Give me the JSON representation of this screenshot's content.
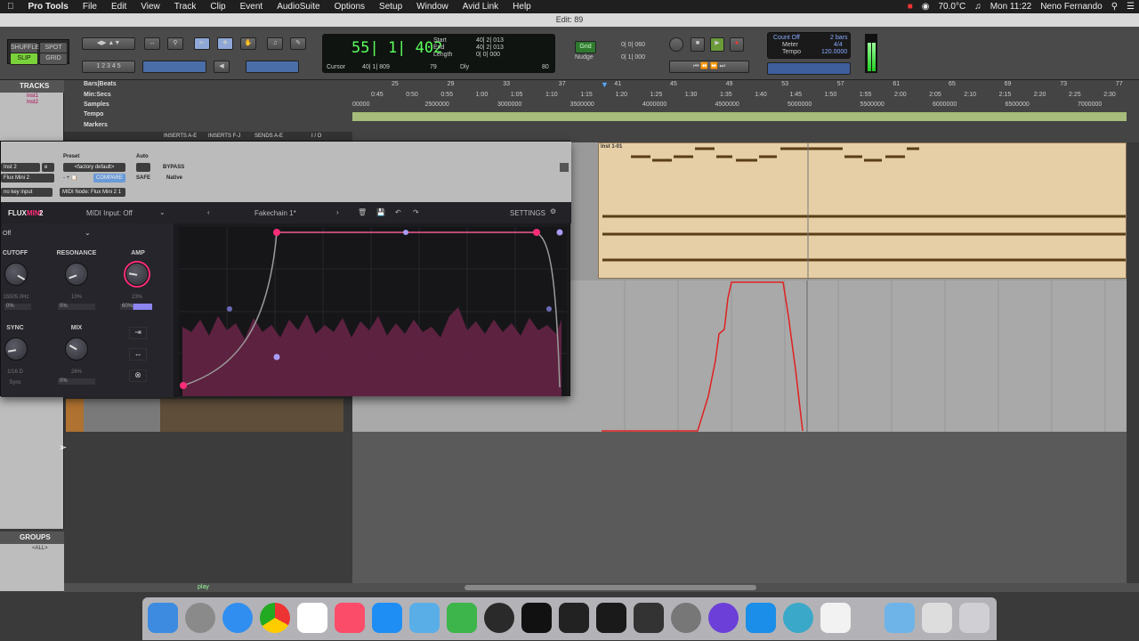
{
  "menubar": {
    "app": "Pro Tools",
    "items": [
      "File",
      "Edit",
      "View",
      "Track",
      "Clip",
      "Event",
      "AudioSuite",
      "Options",
      "Setup",
      "Window",
      "Avid Link",
      "Help"
    ],
    "temp": "70.0°C",
    "clock": "Mon 11:22",
    "user": "Neno Fernando"
  },
  "window_title": "Edit: 89",
  "toolbar": {
    "modes": [
      "SHUFFLE",
      "SPOT",
      "SLIP",
      "GRID"
    ],
    "main_counter": "55| 1| 402",
    "start_lbl": "Start",
    "end_lbl": "End",
    "length_lbl": "Length",
    "start": "40| 2| 013",
    "end": "40| 2| 013",
    "length": "0| 0| 000",
    "cursor_lbl": "Cursor",
    "cursor": "40| 1| 809",
    "cursor_num": "79",
    "dly": "Dly",
    "grid_lbl": "Grid",
    "grid_val": "0| 0| 060",
    "nudge_lbl": "Nudge",
    "nudge_val": "0| 1| 000",
    "count_off": "Count Off",
    "meter": "Meter",
    "tempo": "Tempo",
    "bars": "2 bars",
    "meter_val": "4/4",
    "tempo_val": "120.0000",
    "cursor_badge": "80"
  },
  "rulers": {
    "labels": [
      "Bars|Beats",
      "Min:Secs",
      "Samples",
      "Tempo",
      "Markers"
    ],
    "bars": [
      {
        "t": "25"
      },
      {
        "t": "29"
      },
      {
        "t": "33"
      },
      {
        "t": "37"
      },
      {
        "t": "41"
      },
      {
        "t": "45"
      },
      {
        "t": "49"
      },
      {
        "t": "53"
      },
      {
        "t": "57"
      },
      {
        "t": "61"
      },
      {
        "t": "65"
      },
      {
        "t": "69"
      },
      {
        "t": "73"
      },
      {
        "t": "77"
      }
    ],
    "mins": [
      "0:45",
      "0:50",
      "0:55",
      "1:00",
      "1:05",
      "1:10",
      "1:15",
      "1:20",
      "1:25",
      "1:30",
      "1:35",
      "1:40",
      "1:45",
      "1:50",
      "1:55",
      "2:00",
      "2:05",
      "2:10",
      "2:15",
      "2:20",
      "2:25",
      "2:30"
    ],
    "samples": [
      "00000",
      "2500000",
      "3000000",
      "3500000",
      "4000000",
      "4500000",
      "5000000",
      "5500000",
      "6000000",
      "6500000",
      "7000000"
    ],
    "inserts": [
      "INSERTS A-E",
      "INSERTS F-J",
      "SENDS A-E",
      "I / O"
    ]
  },
  "tracks": {
    "header": "TRACKS",
    "list": [
      "Inst1",
      "Inst2"
    ]
  },
  "groups": {
    "header": "GROUPS",
    "all": "<ALL>"
  },
  "clip": {
    "name": "Inst 1-01"
  },
  "plugin": {
    "track": "Inst 2",
    "track_num": "e",
    "preset_lbl": "Preset",
    "auto_lbl": "Auto",
    "preset": "<factory default>",
    "bypass": "BYPASS",
    "compare": "COMPARE",
    "safe": "SAFE",
    "native": "Native",
    "insert": "Flux Mini 2",
    "key": "no key input",
    "node": "MIDI Node: Flux Mini 2 1",
    "brand": "FLUX",
    "brand2": "MINI",
    "brand3": "2",
    "midi": "MIDI Input: Off",
    "preset_name": "Fakechain 1*",
    "settings": "SETTINGS",
    "off_sel": "Off",
    "knobs": [
      {
        "label": "CUTOFF",
        "value": "15505.0Hz",
        "mod": "0%"
      },
      {
        "label": "RESONANCE",
        "value": "10%",
        "mod": "0%"
      },
      {
        "label": "AMP",
        "value": "23%",
        "mod": "60%"
      },
      {
        "label": "SYNC",
        "value": "1/16 D",
        "mod": "Sync"
      },
      {
        "label": "MIX",
        "value": "26%",
        "mod": "0%"
      }
    ]
  },
  "status": {
    "play": "play"
  },
  "colors": {
    "accent": "#ff2d78",
    "midi_note": "#5a3e18",
    "automation": "#e02020",
    "counter_green": "#5dff5d"
  }
}
